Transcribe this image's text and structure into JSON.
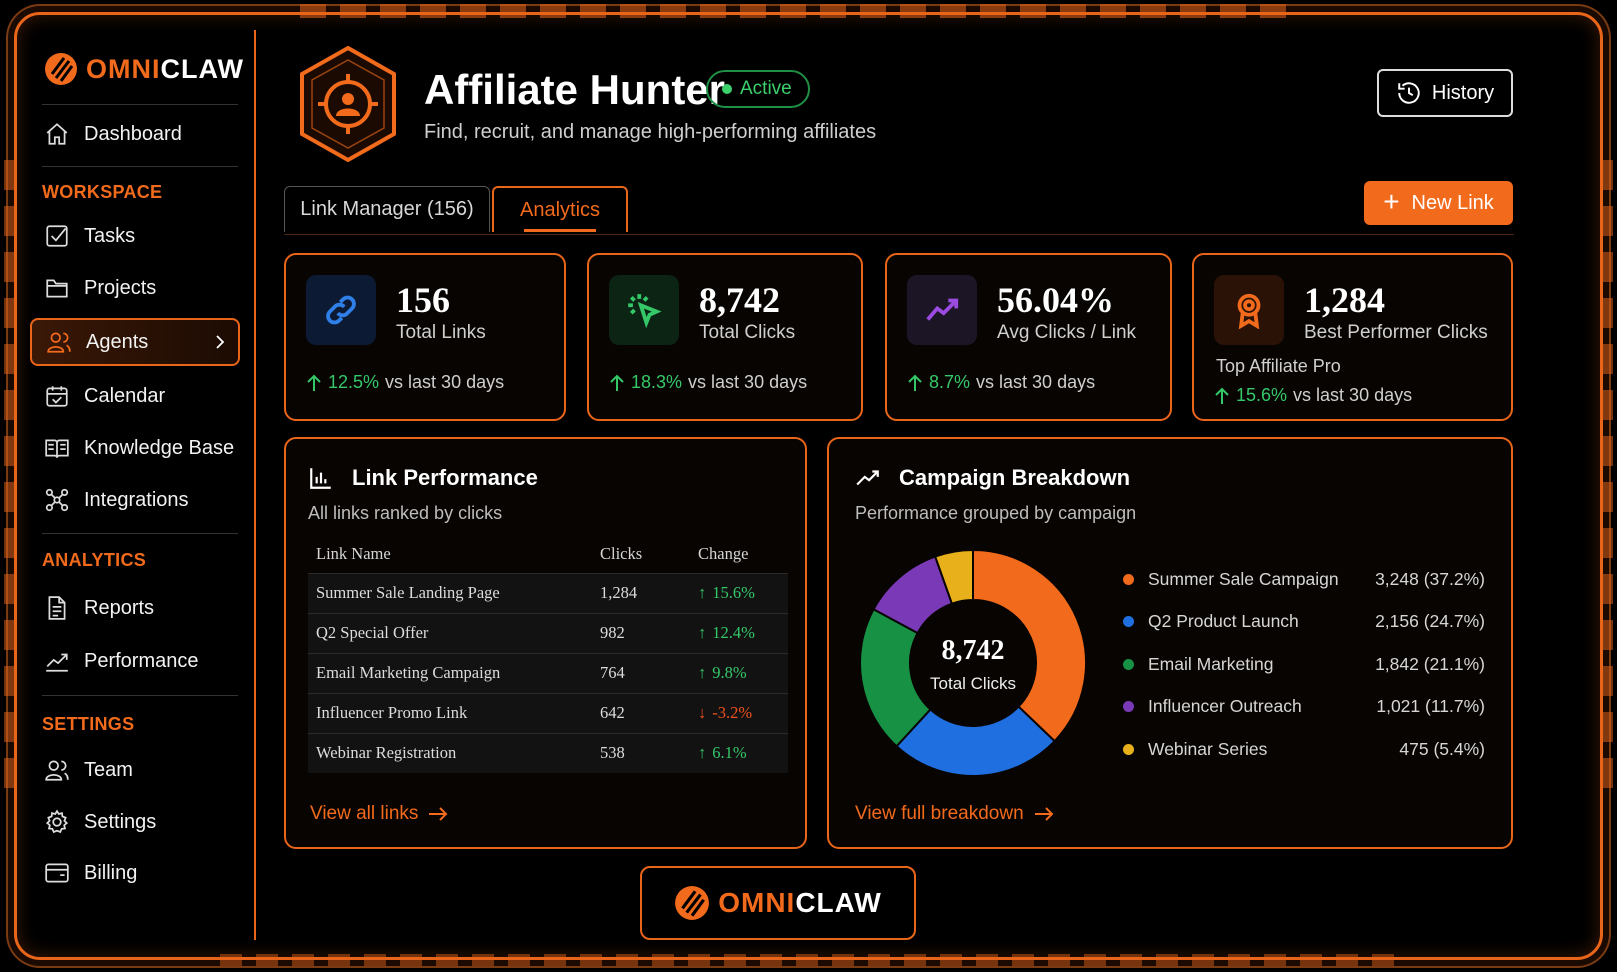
{
  "brand": {
    "name_a": "OMNI",
    "name_b": "CLAW",
    "accent": "#f26a1b"
  },
  "sidebar": {
    "top_items": [
      {
        "label": "Dashboard",
        "icon": "home-icon"
      }
    ],
    "sections": [
      {
        "title": "WORKSPACE",
        "items": [
          {
            "label": "Tasks",
            "icon": "checkbox-icon"
          },
          {
            "label": "Projects",
            "icon": "folder-icon"
          },
          {
            "label": "Agents",
            "icon": "users-icon",
            "active": true
          },
          {
            "label": "Calendar",
            "icon": "calendar-icon"
          },
          {
            "label": "Knowledge Base",
            "icon": "book-icon"
          },
          {
            "label": "Integrations",
            "icon": "network-icon"
          }
        ]
      },
      {
        "title": "ANALYTICS",
        "items": [
          {
            "label": "Reports",
            "icon": "document-icon"
          },
          {
            "label": "Performance",
            "icon": "trend-icon"
          }
        ]
      },
      {
        "title": "SETTINGS",
        "items": [
          {
            "label": "Team",
            "icon": "team-icon"
          },
          {
            "label": "Settings",
            "icon": "gear-icon"
          },
          {
            "label": "Billing",
            "icon": "wallet-icon"
          }
        ]
      }
    ]
  },
  "header": {
    "title": "Affiliate Hunter",
    "status": "Active",
    "subtitle": "Find, recruit, and manage high-performing affiliates",
    "history_label": "History",
    "new_link_label": "New Link"
  },
  "tabs": [
    {
      "label": "Link Manager (156)",
      "active": false
    },
    {
      "label": "Analytics",
      "active": true
    }
  ],
  "stats": [
    {
      "value": "156",
      "label": "Total Links",
      "change": "12.5%",
      "suffix": "vs last 30 days",
      "icon": "link-icon",
      "color": "#2f7fe8"
    },
    {
      "value": "8,742",
      "label": "Total Clicks",
      "change": "18.3%",
      "suffix": "vs last 30 days",
      "icon": "cursor-click-icon",
      "color": "#35c869"
    },
    {
      "value": "56.04%",
      "label": "Avg Clicks / Link",
      "change": "8.7%",
      "suffix": "vs last 30 days",
      "icon": "trend-up-icon",
      "color": "#9b4be0"
    },
    {
      "value": "1,284",
      "label": "Best Performer Clicks",
      "extra": "Top Affiliate Pro",
      "change": "15.6%",
      "suffix": "vs last 30 days",
      "icon": "award-icon",
      "color": "#f26a1b"
    }
  ],
  "link_performance": {
    "title": "Link Performance",
    "subtitle": "All links ranked by clicks",
    "columns": [
      "Link Name",
      "Clicks",
      "Change"
    ],
    "rows": [
      {
        "name": "Summer Sale Landing Page",
        "clicks": "1,284",
        "change": "15.6%",
        "dir": "up"
      },
      {
        "name": "Q2 Special Offer",
        "clicks": "982",
        "change": "12.4%",
        "dir": "up"
      },
      {
        "name": "Email Marketing Campaign",
        "clicks": "764",
        "change": "9.8%",
        "dir": "up"
      },
      {
        "name": "Influencer Promo Link",
        "clicks": "642",
        "change": "-3.2%",
        "dir": "down"
      },
      {
        "name": "Webinar Registration",
        "clicks": "538",
        "change": "6.1%",
        "dir": "up"
      }
    ],
    "link_label": "View all links"
  },
  "campaign_breakdown": {
    "title": "Campaign Breakdown",
    "subtitle": "Performance grouped by campaign",
    "center_value": "8,742",
    "center_label": "Total Clicks",
    "link_label": "View full breakdown",
    "items": [
      {
        "name": "Summer Sale Campaign",
        "display": "3,248 (37.2%)",
        "color": "#f26a1b"
      },
      {
        "name": "Q2 Product Launch",
        "display": "2,156 (24.7%)",
        "color": "#1f6fe0"
      },
      {
        "name": "Email Marketing",
        "display": "1,842 (21.1%)",
        "color": "#179144"
      },
      {
        "name": "Influencer Outreach",
        "display": "1,021 (11.7%)",
        "color": "#7a3ab8"
      },
      {
        "name": "Webinar Series",
        "display": "475 (5.4%)",
        "color": "#e8b01a"
      }
    ]
  },
  "chart_data": {
    "type": "pie",
    "categories": [
      "Summer Sale Campaign",
      "Q2 Product Launch",
      "Email Marketing",
      "Influencer Outreach",
      "Webinar Series"
    ],
    "values": [
      3248,
      2156,
      1842,
      1021,
      475
    ],
    "percentages": [
      37.2,
      24.7,
      21.1,
      11.7,
      5.4
    ],
    "title": "Campaign Breakdown",
    "legend": "right"
  }
}
